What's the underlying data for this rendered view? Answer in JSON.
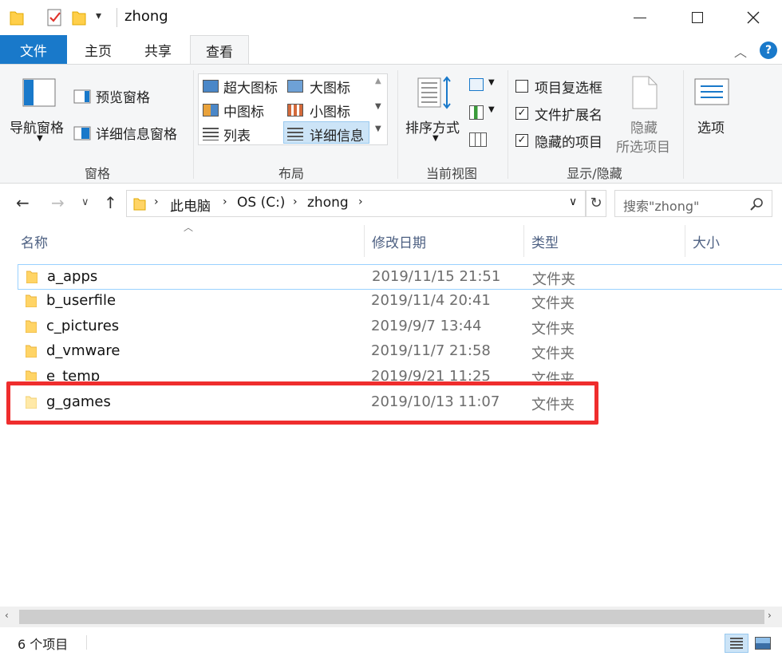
{
  "window": {
    "title": "zhong"
  },
  "tabs": [
    "文件",
    "主页",
    "共享",
    "查看"
  ],
  "ribbon": {
    "pane": {
      "nav_pane": "导航窗格",
      "preview_pane": "预览窗格",
      "details_pane": "详细信息窗格",
      "label": "窗格"
    },
    "layout": {
      "items": [
        "超大图标",
        "大图标",
        "中图标",
        "小图标",
        "列表",
        "详细信息"
      ],
      "label": "布局"
    },
    "current_view": {
      "sort_by": "排序方式",
      "label": "当前视图"
    },
    "show_hide": {
      "item_checkboxes": {
        "label": "项目复选框",
        "checked": false
      },
      "file_extensions": {
        "label": "文件扩展名",
        "checked": true
      },
      "hidden_items": {
        "label": "隐藏的项目",
        "checked": true
      },
      "hide_selected_1": "隐藏",
      "hide_selected_2": "所选项目",
      "label": "显示/隐藏"
    },
    "options": "选项"
  },
  "address": {
    "crumbs": [
      "此电脑",
      "OS (C:)",
      "zhong"
    ],
    "search_placeholder": "搜索\"zhong\""
  },
  "columns": {
    "name": "名称",
    "date": "修改日期",
    "type": "类型",
    "size": "大小"
  },
  "files": [
    {
      "name": "a_apps",
      "date": "2019/11/15 21:51",
      "type": "文件夹"
    },
    {
      "name": "b_userfile",
      "date": "2019/11/4 20:41",
      "type": "文件夹"
    },
    {
      "name": "c_pictures",
      "date": "2019/9/7 13:44",
      "type": "文件夹"
    },
    {
      "name": "d_vmware",
      "date": "2019/11/7 21:58",
      "type": "文件夹"
    },
    {
      "name": "e_temp",
      "date": "2019/9/21 11:25",
      "type": "文件夹"
    },
    {
      "name": "g_games",
      "date": "2019/10/13 11:07",
      "type": "文件夹"
    }
  ],
  "status": {
    "count": "6 个项目"
  },
  "colors": {
    "accent": "#1979ca",
    "highlight": "#ef2d2d",
    "folder": "#ffd466"
  }
}
